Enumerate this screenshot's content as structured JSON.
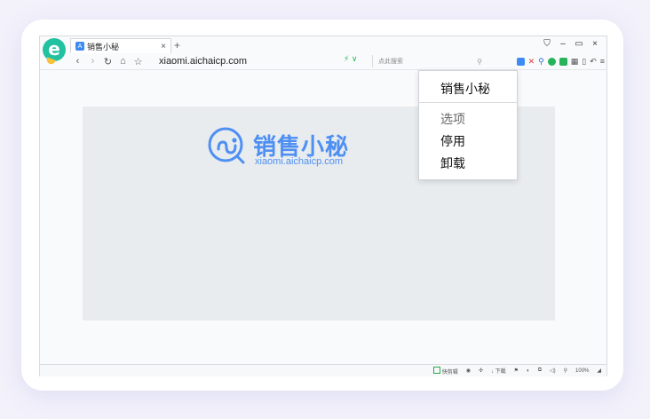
{
  "tab": {
    "title": "销售小秘",
    "favicon": "A",
    "close": "×"
  },
  "new_tab": "+",
  "window_controls": {
    "shirt": "⛉",
    "minimize": "–",
    "maximize": "▭",
    "close": "×"
  },
  "nav": {
    "back": "‹",
    "forward": "›",
    "reload": "↻",
    "home": "⌂",
    "star": "☆"
  },
  "address": {
    "url": "xiaomi.aichaicp.com",
    "speed": "⚡ ∨"
  },
  "search": {
    "placeholder": "点此搜索",
    "icon": "🔍"
  },
  "toolbar_icons": [
    "extension-blue",
    "close-red",
    "search-blue",
    "shield-green",
    "download-green",
    "grid",
    "phone",
    "undo",
    "menu"
  ],
  "menu": {
    "title": "销售小秘",
    "items": [
      "选项",
      "停用",
      "卸载"
    ]
  },
  "banner": {
    "brand_name": "销售小秘",
    "brand_url": "xiaomi.aichaicp.com",
    "accent": "#4e8ff2"
  },
  "status_bar": {
    "snipping": "快剪辑",
    "download": "下载",
    "zoom": "100%"
  }
}
